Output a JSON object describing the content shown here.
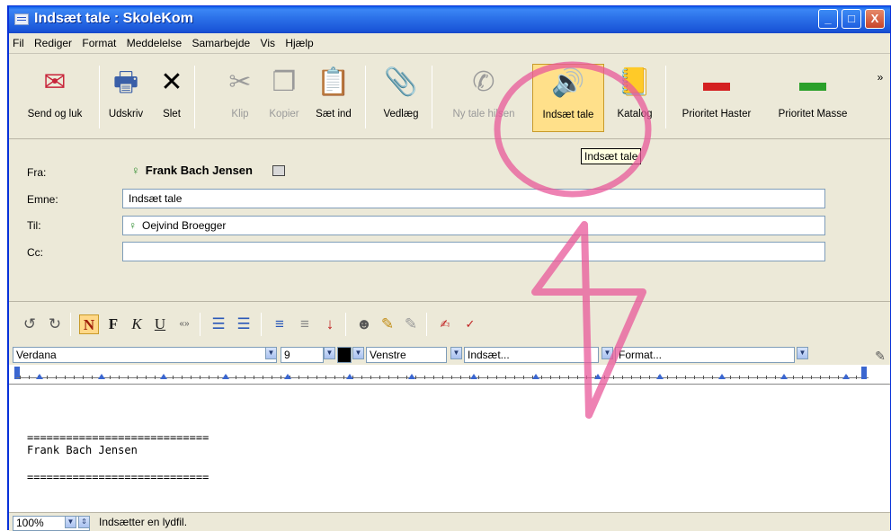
{
  "window": {
    "title": "Indsæt tale : SkoleKom"
  },
  "titlebar_buttons": {
    "minimize": "_",
    "maximize": "□",
    "close": "X"
  },
  "menu": [
    "Fil",
    "Rediger",
    "Format",
    "Meddelelse",
    "Samarbejde",
    "Vis",
    "Hjælp"
  ],
  "toolbar": [
    {
      "label": "Send og luk",
      "icon": "✉",
      "icon_name": "send-close-icon"
    },
    {
      "label": "Udskriv",
      "icon": "🖶",
      "icon_name": "printer-icon"
    },
    {
      "label": "Slet",
      "icon": "✕",
      "icon_name": "delete-icon"
    },
    {
      "label": "Klip",
      "icon": "✂",
      "icon_name": "scissors-icon",
      "disabled": true
    },
    {
      "label": "Kopier",
      "icon": "❐",
      "icon_name": "copy-icon",
      "disabled": true
    },
    {
      "label": "Sæt ind",
      "icon": "📋",
      "icon_name": "paste-icon"
    },
    {
      "label": "Vedlæg",
      "icon": "📎",
      "icon_name": "paperclip-icon"
    },
    {
      "label": "Ny tale hilsen",
      "icon": "✆",
      "icon_name": "voice-greeting-icon",
      "disabled": true
    },
    {
      "label": "Indsæt tale",
      "icon": "🔊",
      "icon_name": "speaker-icon",
      "active": true
    },
    {
      "label": "Katalog",
      "icon": "📒",
      "icon_name": "catalog-icon"
    },
    {
      "label": "Prioritet Haster",
      "icon": "▬",
      "icon_name": "priority-high-icon"
    },
    {
      "label": "Prioritet Masse",
      "icon": "▬",
      "icon_name": "priority-bulk-icon"
    }
  ],
  "tooltip": "Indsæt tale",
  "form": {
    "from_label": "Fra:",
    "from_value": "Frank Bach Jensen",
    "subject_label": "Emne:",
    "subject_value": "Indsæt tale",
    "to_label": "Til:",
    "to_value": "Oejvind Broegger",
    "cc_label": "Cc:",
    "cc_value": ""
  },
  "format_buttons": {
    "bold": "N",
    "f": "F",
    "italic": "K",
    "underline": "U",
    "quote": "«»"
  },
  "combos": {
    "font": "Verdana",
    "size": "9",
    "align": "Venstre",
    "insert": "Indsæt...",
    "format": "Format..."
  },
  "editor": {
    "line1": "============================",
    "line2": "Frank Bach Jensen",
    "line3": "============================"
  },
  "status": {
    "zoom": "100%",
    "text": "Indsætter en lydfil."
  },
  "colors": {
    "titlebar": "#2b70e8",
    "annotation": "#e8589a",
    "active_button": "#ffe08a"
  }
}
